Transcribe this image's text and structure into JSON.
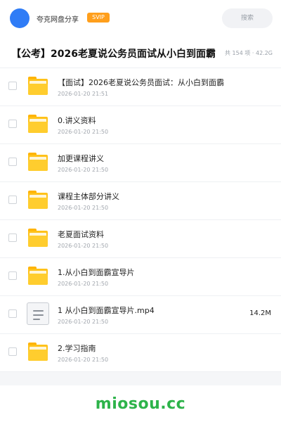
{
  "header": {
    "app_name": "夸克网盘分享",
    "badge": "SVIP",
    "search_placeholder": "搜索"
  },
  "share": {
    "title": "【公考】2026老夏说公务员面试从小白到面霸",
    "summary": "共 154 项 · 42.2G"
  },
  "items": [
    {
      "type": "folder",
      "name": "【面试】2026老夏说公务员面试：从小白到面霸",
      "date": "2026-01-20 21:51",
      "size": ""
    },
    {
      "type": "folder",
      "name": "0.讲义资料",
      "date": "2026-01-20 21:50",
      "size": ""
    },
    {
      "type": "folder",
      "name": "加更课程讲义",
      "date": "2026-01-20 21:50",
      "size": ""
    },
    {
      "type": "folder",
      "name": "课程主体部分讲义",
      "date": "2026-01-20 21:50",
      "size": ""
    },
    {
      "type": "folder",
      "name": "老夏面试资料",
      "date": "2026-01-20 21:50",
      "size": ""
    },
    {
      "type": "folder",
      "name": "1.从小白到面霸宣导片",
      "date": "2026-01-20 21:50",
      "size": ""
    },
    {
      "type": "file",
      "name": "1 从小白到面霸宣导片.mp4",
      "date": "2026-01-20 21:50",
      "size": "14.2M"
    },
    {
      "type": "folder",
      "name": "2.学习指南",
      "date": "2026-01-20 21:50",
      "size": ""
    }
  ],
  "watermark": "miosou.cc",
  "colors": {
    "accent": "#2f7cf6",
    "svip": "#ff9f1c",
    "folder": "#ffc21a",
    "watermark": "#2db34a"
  }
}
